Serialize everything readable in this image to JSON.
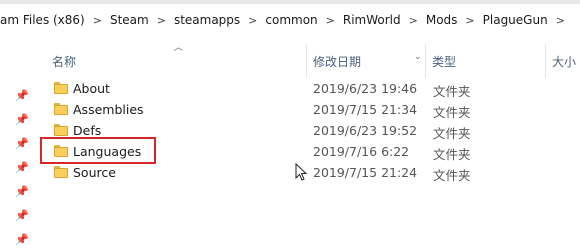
{
  "breadcrumb": [
    "am Files (x86)",
    "Steam",
    "steamapps",
    "common",
    "RimWorld",
    "Mods",
    "PlagueGun"
  ],
  "columns": {
    "name": "名称",
    "date": "修改日期",
    "type": "类型",
    "size": "大小"
  },
  "rows": [
    {
      "name": "About",
      "date": "2019/6/23 19:46",
      "type": "文件夹"
    },
    {
      "name": "Assemblies",
      "date": "2019/7/15 21:34",
      "type": "文件夹"
    },
    {
      "name": "Defs",
      "date": "2019/6/23 19:52",
      "type": "文件夹"
    },
    {
      "name": "Languages",
      "date": "2019/7/16 6:22",
      "type": "文件夹"
    },
    {
      "name": "Source",
      "date": "2019/7/15 21:24",
      "type": "文件夹"
    }
  ],
  "colors": {
    "highlight": "#d9262b",
    "folder": "#f7cf5a",
    "header_text": "#4c607a"
  },
  "icons": {
    "pin": "pin-icon",
    "folder": "folder-icon",
    "sort": "sort-up-icon",
    "separator": "chevron-right-icon"
  }
}
